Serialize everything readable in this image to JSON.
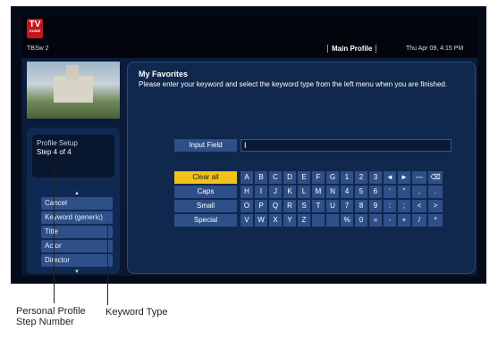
{
  "header": {
    "logo_top": "TV",
    "logo_bottom": "GUIDE",
    "channel": "TBSw 2",
    "profile": "Main Profile",
    "datetime": "Thu Apr 09, 4:15 PM"
  },
  "left": {
    "setup_title": "Profile Setup",
    "step": "Step 4 of 4",
    "scroll_up": "▲",
    "scroll_down": "▼",
    "keyword_types": [
      "Cancel",
      "Keyword (generic)",
      "Title",
      "Actor",
      "Director"
    ]
  },
  "main": {
    "title": "My Favorites",
    "instructions": "Please enter your keyword and select the keyword type from the left menu when you are finished.",
    "input_label": "Input Field",
    "input_value": "I",
    "modes": [
      "Clear all",
      "Caps",
      "Small",
      "Special"
    ],
    "keyboard_rows": [
      [
        "A",
        "B",
        "C",
        "D",
        "E",
        "F",
        "G",
        "1",
        "2",
        "3",
        "◄",
        "►",
        "—",
        "⌫"
      ],
      [
        "H",
        "I",
        "J",
        "K",
        "L",
        "M",
        "N",
        "4",
        "5",
        "6",
        "'",
        "\"",
        ",",
        "."
      ],
      [
        "O",
        "P",
        "Q",
        "R",
        "S",
        "T",
        "U",
        "7",
        "8",
        "9",
        ":",
        ";",
        "<",
        ">"
      ],
      [
        "V",
        "W",
        "X",
        "Y",
        "Z",
        "",
        "",
        "%",
        "0",
        "=",
        "-",
        "+",
        "/",
        "*"
      ]
    ]
  },
  "callouts": {
    "personal": "Personal Profile Step Number",
    "keyword_type": "Keyword Type"
  }
}
